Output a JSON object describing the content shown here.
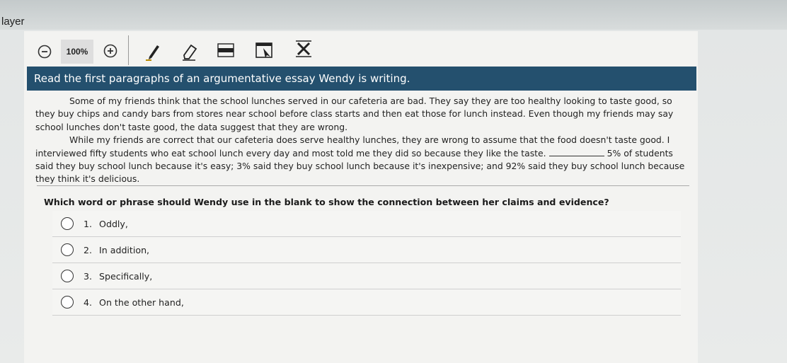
{
  "window": {
    "title": "layer"
  },
  "toolbar": {
    "zoom_out_icon": "minus-circle-icon",
    "zoom_level": "100%",
    "zoom_in_icon": "plus-circle-icon",
    "tools": [
      "pen-icon",
      "eraser-icon",
      "line-tool-icon",
      "answer-masking-icon",
      "cross-out-icon"
    ]
  },
  "passage": {
    "heading": "Read the first paragraphs of an argumentative essay Wendy is writing.",
    "paragraph1": "Some of my friends think that the school lunches served in our cafeteria are bad. They say they are too healthy looking to taste good, so they buy chips and candy bars from stores near school before class starts and then eat those for lunch instead. Even though my friends may say school lunches don't taste good, the data suggest that they are wrong.",
    "paragraph2_before_blank": "While my friends are correct that our cafeteria does serve healthy lunches, they are wrong to assume that the food doesn't taste good. I interviewed fifty students who eat school lunch every day and most told me they did so because they like the taste.",
    "paragraph2_after_blank": "5% of students said they buy school lunch because it's easy; 3% said they buy school lunch because it's inexpensive; and 92% said they buy school lunch because they think it's delicious."
  },
  "question": {
    "prompt": "Which word or phrase should Wendy use in the blank to show the connection between her claims and evidence?",
    "options": [
      {
        "num": "1.",
        "text": "Oddly,"
      },
      {
        "num": "2.",
        "text": "In addition,"
      },
      {
        "num": "3.",
        "text": "Specifically,"
      },
      {
        "num": "4.",
        "text": "On the other hand,"
      }
    ]
  }
}
